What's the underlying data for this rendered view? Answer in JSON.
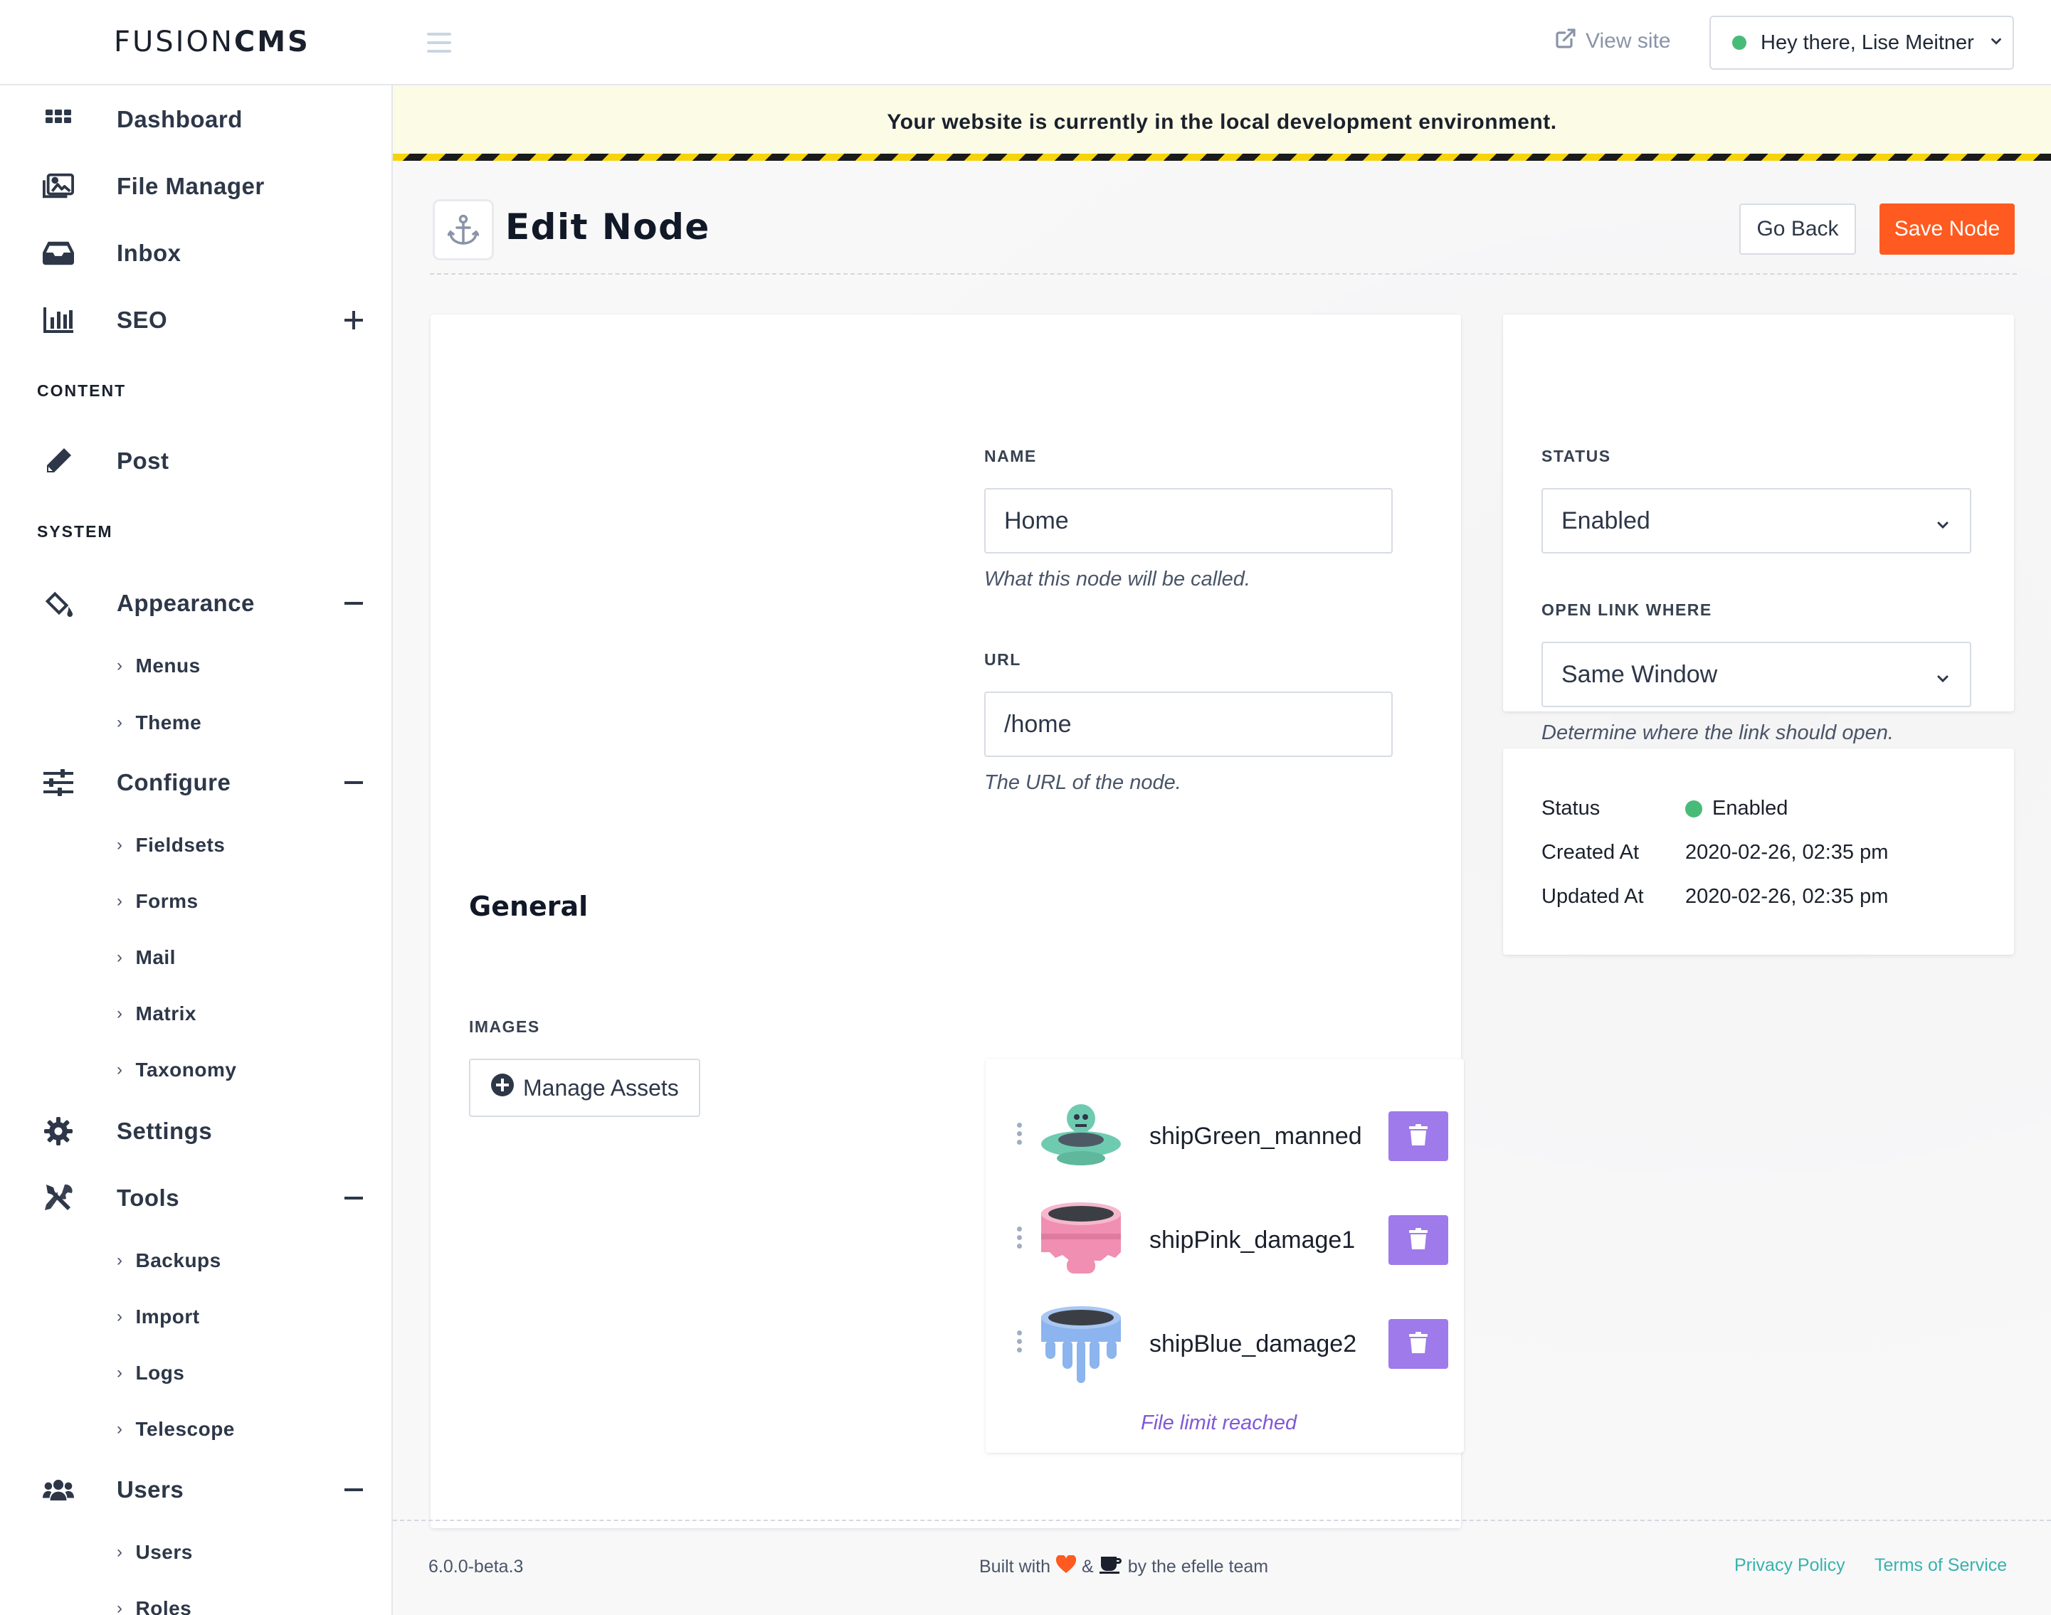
{
  "brand": {
    "logo_light": "FUSION",
    "logo_bold": "CMS"
  },
  "topbar": {
    "view_site": "View site",
    "user_greeting": "Hey there, Lise Meitner",
    "status_color": "#48bb78"
  },
  "sidebar": {
    "items": [
      {
        "label": "Dashboard",
        "icon": "grid-icon"
      },
      {
        "label": "File Manager",
        "icon": "images-icon"
      },
      {
        "label": "Inbox",
        "icon": "inbox-icon"
      },
      {
        "label": "SEO",
        "icon": "chart-bar-icon",
        "toggle": "plus"
      }
    ],
    "content_header": "CONTENT",
    "content_items": [
      {
        "label": "Post",
        "icon": "pencil-icon"
      }
    ],
    "system_header": "SYSTEM",
    "appearance": {
      "label": "Appearance",
      "icon": "paint-bucket-icon",
      "toggle": "minus",
      "children": [
        "Menus",
        "Theme"
      ]
    },
    "configure": {
      "label": "Configure",
      "icon": "sliders-icon",
      "toggle": "minus",
      "children": [
        "Fieldsets",
        "Forms",
        "Mail",
        "Matrix",
        "Taxonomy"
      ]
    },
    "settings": {
      "label": "Settings",
      "icon": "gear-icon"
    },
    "tools": {
      "label": "Tools",
      "icon": "tools-icon",
      "toggle": "minus",
      "children": [
        "Backups",
        "Import",
        "Logs",
        "Telescope"
      ]
    },
    "users": {
      "label": "Users",
      "icon": "users-icon",
      "toggle": "minus",
      "children": [
        "Users",
        "Roles"
      ]
    }
  },
  "banner": {
    "text": "Your website is currently in the local development environment."
  },
  "page": {
    "title": "Edit Node",
    "title_icon": "anchor-icon",
    "go_back": "Go Back",
    "save": "Save Node",
    "accent": "#ff5a1f"
  },
  "form": {
    "section": "General",
    "name": {
      "label": "NAME",
      "value": "Home",
      "help": "What this node will be called."
    },
    "url": {
      "label": "URL",
      "value": "/home",
      "help": "The URL of the node."
    },
    "images": {
      "label": "IMAGES",
      "manage": "Manage Assets",
      "assets": [
        {
          "name": "shipGreen_manned",
          "color": "#6fcbb0"
        },
        {
          "name": "shipPink_damage1",
          "color": "#f08fb2"
        },
        {
          "name": "shipBlue_damage2",
          "color": "#8cb4ee"
        }
      ],
      "limit": "File limit reached",
      "delete_color": "#9f7aea"
    }
  },
  "side_panel": {
    "status": {
      "label": "STATUS",
      "value": "Enabled"
    },
    "open_link": {
      "label": "OPEN LINK WHERE",
      "value": "Same Window",
      "help": "Determine where the link should open."
    }
  },
  "meta": {
    "status_label": "Status",
    "status_value": "Enabled",
    "created_label": "Created At",
    "created_value": "2020-02-26, 02:35 pm",
    "updated_label": "Updated At",
    "updated_value": "2020-02-26, 02:35 pm"
  },
  "footer": {
    "version": "6.0.0-beta.3",
    "built_prefix": "Built with",
    "built_amp": "&",
    "built_suffix": "by the efelle team",
    "privacy": "Privacy Policy",
    "terms": "Terms of Service",
    "link_color": "#38b2ac"
  }
}
